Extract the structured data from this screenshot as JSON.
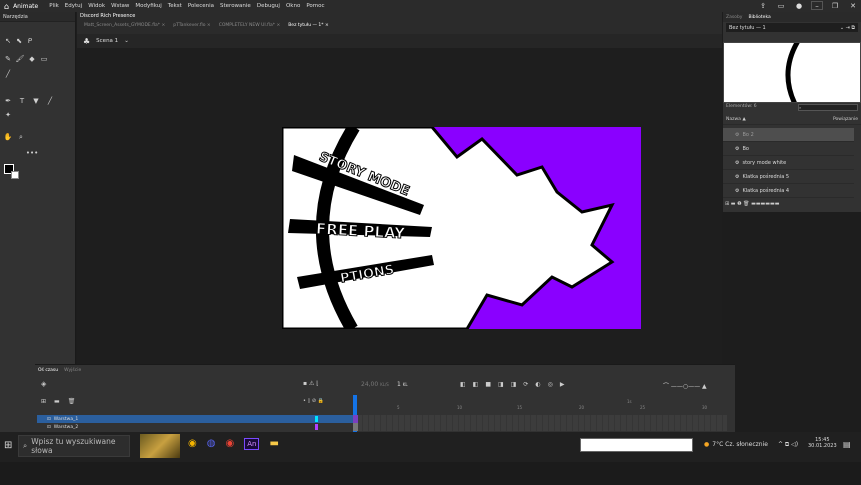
{
  "app": {
    "name": "Animate"
  },
  "menu": [
    "Plik",
    "Edytuj",
    "Widok",
    "Wstaw",
    "Modyfikuj",
    "Tekst",
    "Polecenia",
    "Sterowanie",
    "Debuguj",
    "Okno",
    "Pomoc"
  ],
  "tools": {
    "title": "Narzędzia"
  },
  "discord": "Discord Rich Presence",
  "doc_tabs": [
    {
      "label": "Matt_Screen_Assets_GYMODE.fla* ×",
      "active": false
    },
    {
      "label": "pTTankever.flo ×",
      "active": false
    },
    {
      "label": "COMPLETELY NEW UI.fla* ×",
      "active": false
    },
    {
      "label": "Bez tytułu — 1* ×",
      "active": true
    }
  ],
  "scene": {
    "label": "Scena 1"
  },
  "stage_texts": {
    "story": "STORY MODE",
    "free": "FREE PLAY",
    "options": "PTIONS"
  },
  "right_panel": {
    "tabs": [
      "Zasoby",
      "Biblioteka"
    ],
    "doc_select": "Bez tytułu — 1",
    "elements_count": "Elementów: 6",
    "name_header": "Nazwa ▲",
    "linkage_header": "Powiązanie",
    "items": [
      "Bo 2",
      "Bo",
      "story mode white",
      "Klatka pośrednia 5",
      "Klatka pośrednia 4"
    ]
  },
  "timeline": {
    "tabs": [
      "Oś czasu",
      "Wyjście"
    ],
    "fps": "24,00",
    "fps_unit": "KL/S",
    "frame": "1",
    "frame_unit": "KL",
    "layers": [
      "Warstwa_1",
      "Warstwa_2"
    ],
    "ruler": [
      "5",
      "10",
      "15",
      "20",
      "25",
      "30"
    ],
    "ruler_sec": "1s"
  },
  "taskbar": {
    "search_placeholder": "Wpisz tu wyszukiwane słowa",
    "weather": "7°C  Cz. słonecznie",
    "time": "15:45",
    "date": "30.01.2023"
  },
  "colors": {
    "accent": "#1473e6",
    "purple": "#8a00ff",
    "layer_sel": "#2b5f9e"
  }
}
